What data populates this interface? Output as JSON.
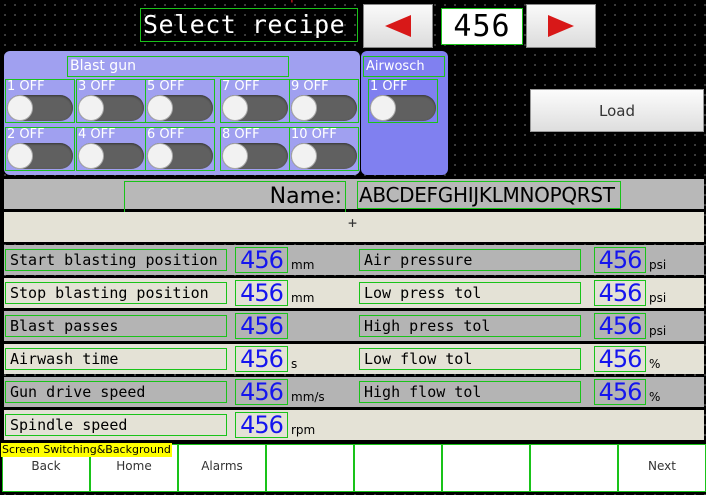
{
  "header": {
    "title": "Select recipe",
    "recipe_number": "456",
    "prev_icon": "triangle-left-icon",
    "next_icon": "triangle-right-icon",
    "arrow_color": "#d81818"
  },
  "blast_gun": {
    "title": "Blast gun",
    "toggles": [
      {
        "label": "1 OFF",
        "state": "off"
      },
      {
        "label": "3 OFF",
        "state": "off"
      },
      {
        "label": "5 OFF",
        "state": "off"
      },
      {
        "label": "7 OFF",
        "state": "off"
      },
      {
        "label": "9 OFF",
        "state": "off"
      },
      {
        "label": "2 OFF",
        "state": "off"
      },
      {
        "label": "4 OFF",
        "state": "off"
      },
      {
        "label": "6 OFF",
        "state": "off"
      },
      {
        "label": "8 OFF",
        "state": "off"
      },
      {
        "label": "10 OFF",
        "state": "off"
      }
    ]
  },
  "airwash": {
    "title": "Airwosch",
    "toggles": [
      {
        "label": "1 OFF",
        "state": "off"
      }
    ]
  },
  "load_button": "Load",
  "name_row": {
    "label": "Name:",
    "value": "ABCDEFGHIJKLMNOPQRST"
  },
  "left_params": [
    {
      "label": "Start blasting position",
      "value": "456",
      "unit": "mm"
    },
    {
      "label": "Stop blasting position",
      "value": "456",
      "unit": "mm"
    },
    {
      "label": "Blast passes",
      "value": "456",
      "unit": ""
    },
    {
      "label": "Airwash time",
      "value": "456",
      "unit": "s"
    },
    {
      "label": "Gun drive speed",
      "value": "456",
      "unit": "mm/s"
    },
    {
      "label": "Spindle speed",
      "value": "456",
      "unit": "rpm"
    }
  ],
  "right_params": [
    {
      "label": "Air pressure",
      "value": "456",
      "unit": "psi"
    },
    {
      "label": "Low press tol",
      "value": "456",
      "unit": "psi"
    },
    {
      "label": "High press tol",
      "value": "456",
      "unit": "psi"
    },
    {
      "label": "Low flow tol",
      "value": "456",
      "unit": "%"
    },
    {
      "label": "High flow tol",
      "value": "456",
      "unit": "%"
    }
  ],
  "status_text": "Screen Switching&Background",
  "nav": [
    {
      "label": "Back"
    },
    {
      "label": "Home"
    },
    {
      "label": "Alarms"
    },
    {
      "label": ""
    },
    {
      "label": ""
    },
    {
      "label": ""
    },
    {
      "label": ""
    },
    {
      "label": "Next"
    }
  ]
}
